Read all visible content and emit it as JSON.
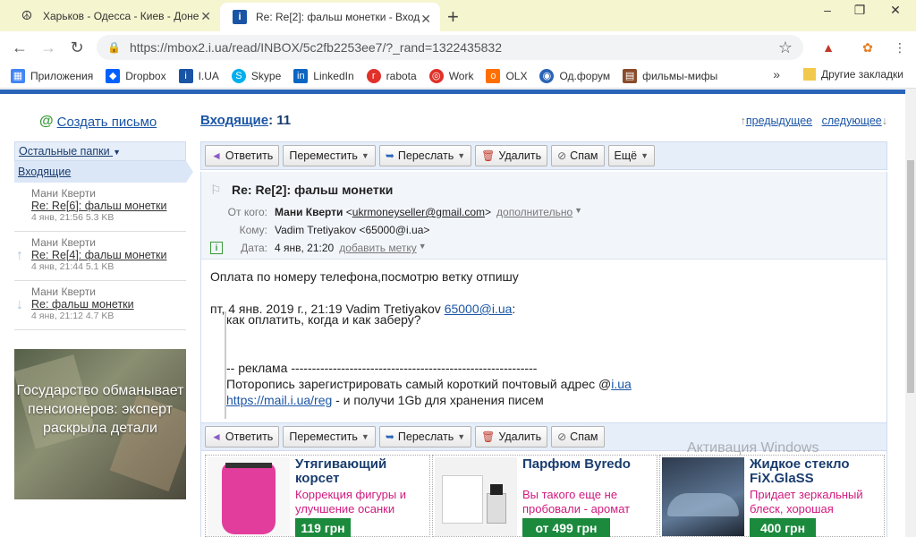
{
  "browser": {
    "tabs": [
      {
        "title": "Харьков - Одесса - Киев - Доне",
        "icon": "peace-icon"
      },
      {
        "title": "Re: Re[2]: фальш монетки - Вход",
        "icon": "iua-icon"
      }
    ],
    "url": "https://mbox2.i.ua/read/INBOX/5c2fb2253ee7/?_rand=1322435832",
    "bookmarks": [
      {
        "label": "Приложения",
        "icon": "apps-icon",
        "color": "#4285f4"
      },
      {
        "label": "Dropbox",
        "icon": "dropbox-icon",
        "color": "#0061ff"
      },
      {
        "label": "I.UA",
        "icon": "iua-icon",
        "color": "#1a55a5"
      },
      {
        "label": "Skype",
        "icon": "skype-icon",
        "color": "#00aff0"
      },
      {
        "label": "LinkedIn",
        "icon": "linkedin-icon",
        "color": "#0a66c2"
      },
      {
        "label": "rabota",
        "icon": "rabota-icon",
        "color": "#e0312a"
      },
      {
        "label": "Work",
        "icon": "work-icon",
        "color": "#e0312a"
      },
      {
        "label": "OLX",
        "icon": "olx-icon",
        "color": "#ff6f00"
      },
      {
        "label": "Од.форум",
        "icon": "forum-icon",
        "color": "#2a64b8"
      },
      {
        "label": "фильмы-мифы",
        "icon": "film-icon",
        "color": "#8a4b2a"
      }
    ],
    "other_bookmarks": "Другие закладки"
  },
  "sidebar": {
    "compose": "Создать письмо",
    "other_folders": "Остальные папки",
    "inbox": "Входящие",
    "threads": [
      {
        "from": "Мани Кверти",
        "subject": "Re: Re[6]: фальш монетки",
        "meta": "4 янв, 21:56 5.3 KB",
        "arrow": ""
      },
      {
        "from": "Мани Кверти",
        "subject": "Re: Re[4]: фальш монетки",
        "meta": "4 янв, 21:44 5.1 KB",
        "arrow": "↑"
      },
      {
        "from": "Мани Кверти",
        "subject": "Re: фальш монетки",
        "meta": "4 янв, 21:12 4.7 KB",
        "arrow": "↓"
      }
    ],
    "ad": "Государство обманывает пенсионеров: эксперт раскрыла детали"
  },
  "main": {
    "title": "Входящие",
    "count": ": 11",
    "prev": "предыдущее",
    "next": "следующее",
    "toolbar": {
      "reply": "Ответить",
      "move": "Переместить",
      "forward": "Переслать",
      "delete": "Удалить",
      "spam": "Спам",
      "more": "Ещё"
    },
    "message": {
      "subject": "Re: Re[2]: фальш монетки",
      "from_label": "От кого:",
      "from_name": "Мани Кверти",
      "from_email": "ukrmoneyseller@gmail.com",
      "details": "дополнительно",
      "to_label": "Кому:",
      "to_value": "Vadim Tretiyakov <65000@i.ua>",
      "date_label": "Дата:",
      "date_value": "4 янв, 21:20",
      "add_label": "добавить метку",
      "body_line1": "Оплата по номеру телефона,посмотрю ветку отпишу",
      "quote_header": "пт, 4 янв. 2019 г., 21:19 Vadim Tretiyakov",
      "quote_email": "65000@i.ua",
      "quote_colon": ":",
      "quote_line": "как оплатить, когда и как заберу?",
      "ad_line": "-- реклама -----------------------------------------------------------",
      "ad_text": "Поторопись зарегистрировать самый короткий почтовый адрес @",
      "ad_link1": "i.ua",
      "ad_link2": "https://mail.i.ua/reg",
      "ad_tail": " - и получи 1Gb для хранения писем"
    }
  },
  "products": [
    {
      "title": "Утягивающий корсет",
      "desc": "Коррекция фигуры и улучшение осанки",
      "price": "119 грн"
    },
    {
      "title": "Парфюм Byredo",
      "desc": "Вы такого еще не пробовали - аромат огня, земли",
      "price": "от 499 грн"
    },
    {
      "title": "Жидкое стекло FiX.GlaSS",
      "desc": "Придает зеркальный блеск, хорошая",
      "price": "400 грн"
    }
  ],
  "watermark": "Активация Windows"
}
